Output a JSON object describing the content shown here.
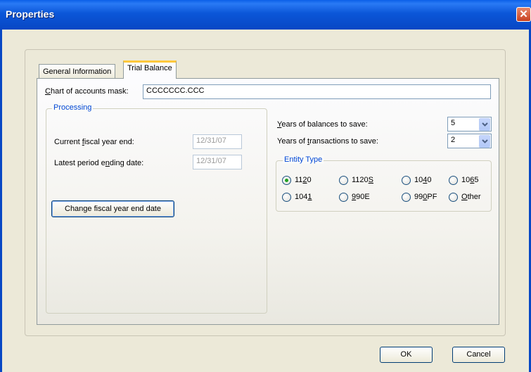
{
  "window": {
    "title": "Properties",
    "close_glyph": "✕"
  },
  "tabs": [
    {
      "label": "General Information"
    },
    {
      "label": "Trial Balance"
    }
  ],
  "trial_balance": {
    "mask_label": "Chart of accounts mask:",
    "mask_value": "CCCCCCC.CCC",
    "processing": {
      "legend": "Processing",
      "fiscal_year_end_label": "Current fiscal year end:",
      "fiscal_year_end_value": "12/31/07",
      "latest_period_label": "Latest period ending date:",
      "latest_period_value": "12/31/07",
      "change_button_label": "Change fiscal year end date"
    },
    "years_balances_label": "Years of balances to save:",
    "years_balances_value": "5",
    "years_transactions_label": "Years of transactions to save:",
    "years_transactions_value": "2",
    "entity_type": {
      "legend": "Entity Type",
      "options": [
        {
          "label": "1120",
          "selected": true
        },
        {
          "label": "1120S",
          "selected": false
        },
        {
          "label": "1040",
          "selected": false
        },
        {
          "label": "1065",
          "selected": false
        },
        {
          "label": "1041",
          "selected": false
        },
        {
          "label": "990E",
          "selected": false
        },
        {
          "label": "990PF",
          "selected": false
        },
        {
          "label": "Other",
          "selected": false
        }
      ]
    }
  },
  "footer": {
    "ok_label": "OK",
    "cancel_label": "Cancel"
  },
  "colors": {
    "title_bar": "#0847c4",
    "legend_text": "#0046d5",
    "active_tab_accent": "#ffc83c",
    "radio_selected": "#21a121"
  }
}
